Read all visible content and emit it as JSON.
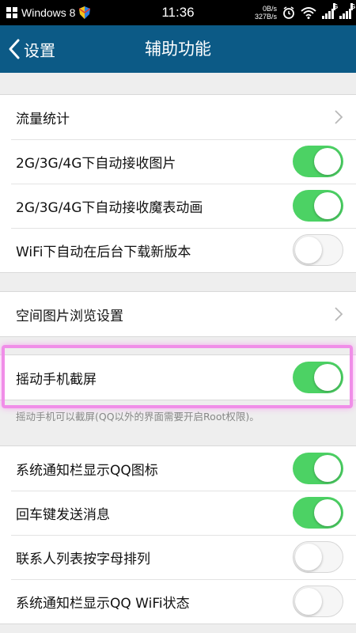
{
  "status_bar": {
    "carrier": "Windows 8",
    "time": "11:36",
    "speed_top": "0B/s",
    "speed_bottom": "327B/s",
    "signal_tag": "G"
  },
  "app_bar": {
    "back_label": "设置",
    "title": "辅助功能"
  },
  "section1": [
    {
      "label": "流量统计",
      "control": "chevron"
    },
    {
      "label": "2G/3G/4G下自动接收图片",
      "control": "toggle",
      "on": true
    },
    {
      "label": "2G/3G/4G下自动接收魔表动画",
      "control": "toggle",
      "on": true
    },
    {
      "label": "WiFi下自动在后台下载新版本",
      "control": "toggle",
      "on": false
    }
  ],
  "section2": [
    {
      "label": "空间图片浏览设置",
      "control": "chevron"
    }
  ],
  "section3": [
    {
      "label": "摇动手机截屏",
      "control": "toggle",
      "on": true
    }
  ],
  "section3_note": "摇动手机可以截屏(QQ以外的界面需要开启Root权限)。",
  "section4": [
    {
      "label": "系统通知栏显示QQ图标",
      "control": "toggle",
      "on": true
    },
    {
      "label": "回车键发送消息",
      "control": "toggle",
      "on": true
    },
    {
      "label": "联系人列表按字母排列",
      "control": "toggle",
      "on": false
    },
    {
      "label": "系统通知栏显示QQ WiFi状态",
      "control": "toggle",
      "on": false
    }
  ],
  "colors": {
    "app_bar": "#0c5a86",
    "toggle_on": "#4cd264",
    "highlight": "#f08ee8"
  }
}
